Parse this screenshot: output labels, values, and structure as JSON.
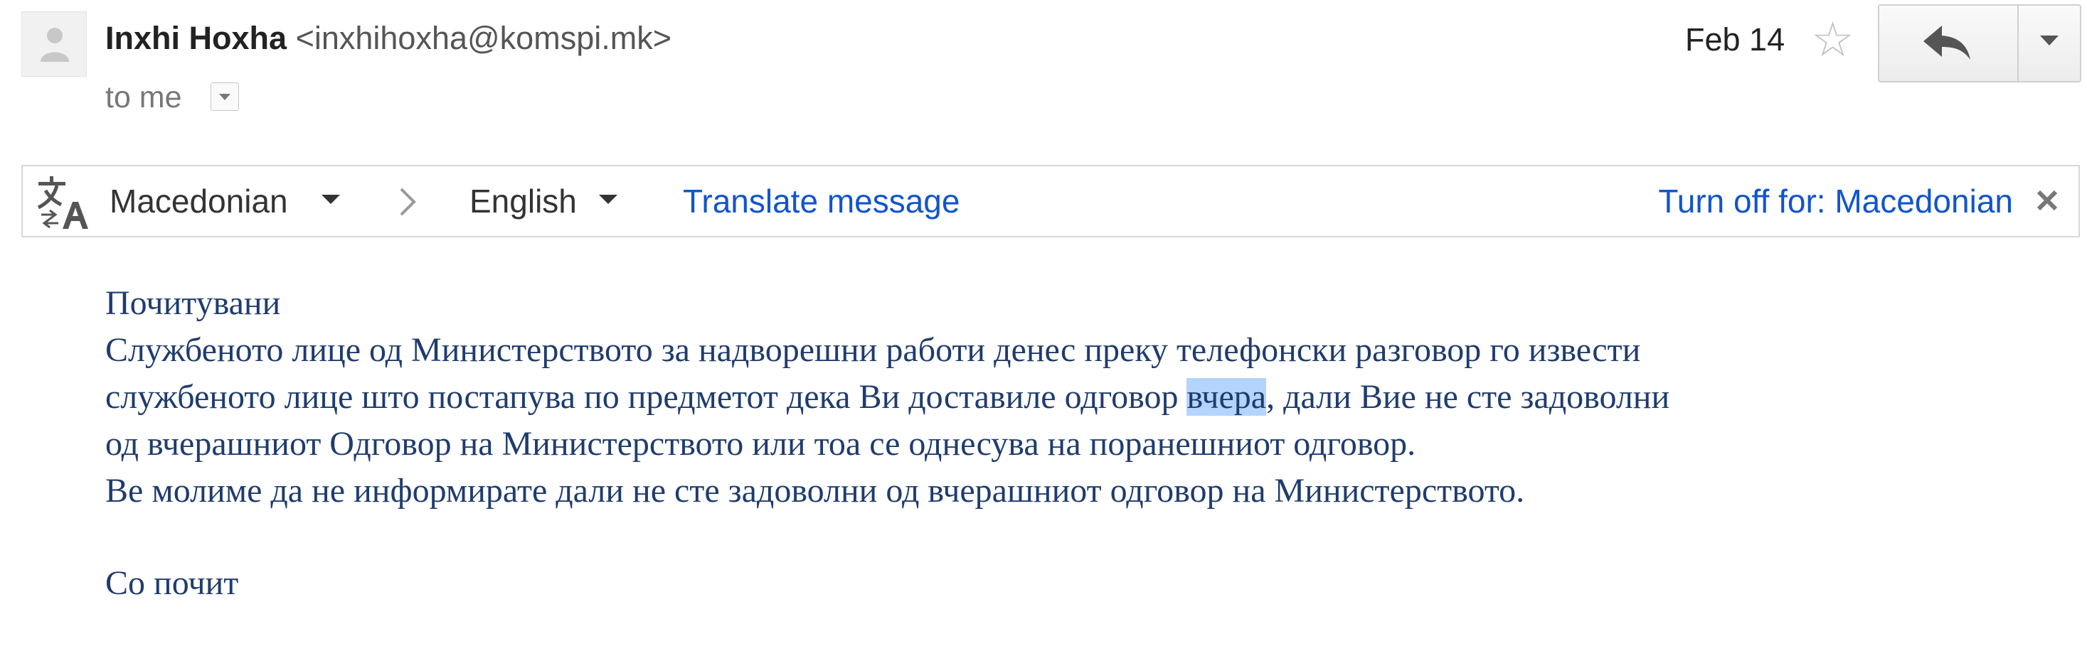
{
  "header": {
    "sender_name": "Inxhi Hoxha",
    "sender_email": "<inxhihoxha@komspi.mk>",
    "recipient": "to me",
    "date": "Feb 14"
  },
  "icons": {
    "avatar": "person-avatar-icon",
    "star": "star-icon",
    "reply": "reply-icon",
    "more": "chevron-down-icon",
    "translate": "translate-icon",
    "separator": "chevron-right-icon",
    "close": "close-icon"
  },
  "translate_bar": {
    "source_language": "Macedonian",
    "target_language": "English",
    "translate_link": "Translate message",
    "turn_off_link": "Turn off for: Macedonian"
  },
  "body": {
    "greeting": "Почитувани",
    "line1": "Службеното лице од Министерството за надворешни работи денес преку телефонски разговор го извести",
    "line2_before": "службеното лице што постапува по предметот дека Ви доставиле одговор ",
    "line2_highlight": "вчера",
    "line2_after": ", дали Вие не сте задоволни",
    "line3": "од вчерашниот Одговор на Министерството или тоа се однесува на поранешниот одговор.",
    "line4": "Ве молиме да не информирате дали не сте задоволни од вчерашниот одговор на Министерството.",
    "closing": "Со почит"
  },
  "colors": {
    "link": "#1155cc",
    "body_text": "#1f3c6e",
    "selection": "#b3d4fc"
  }
}
